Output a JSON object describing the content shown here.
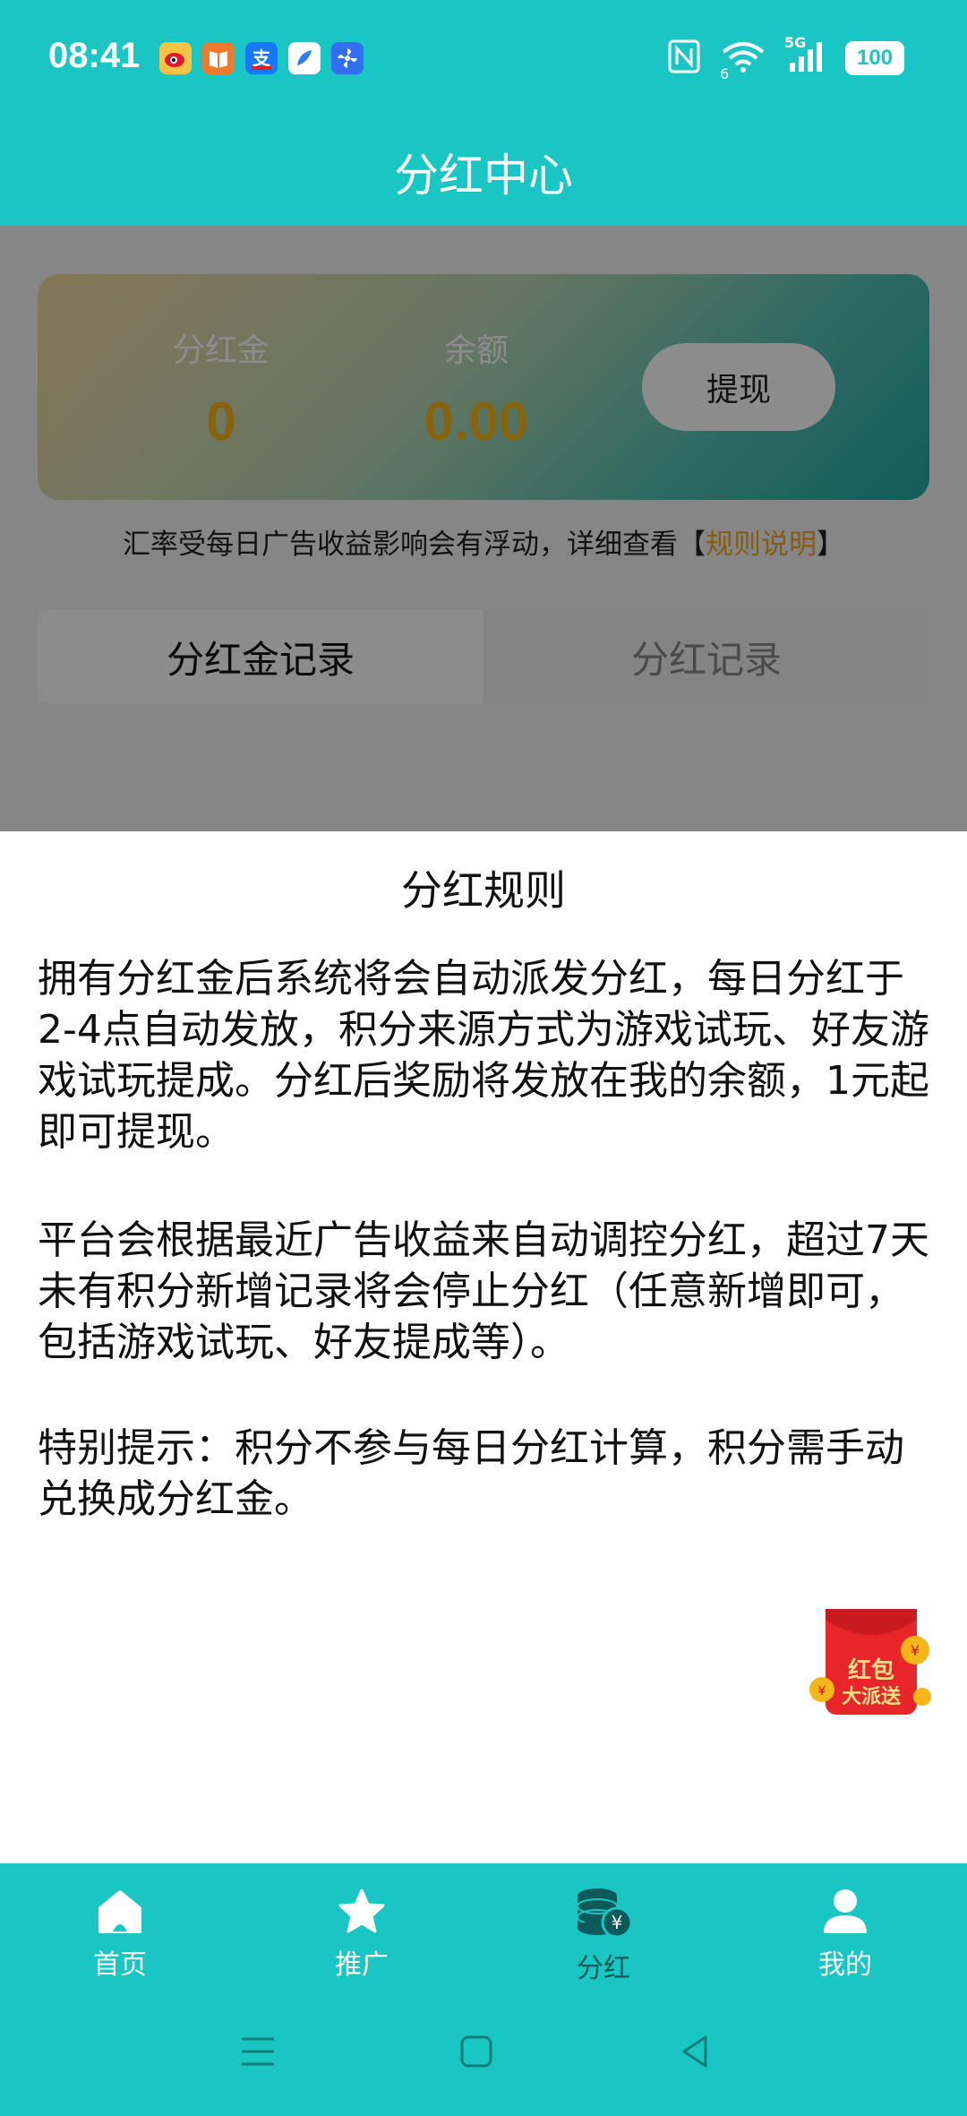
{
  "status_bar": {
    "time": "08:41",
    "notification_icons": [
      "weibo-icon",
      "reader-icon",
      "alipay-icon",
      "browser-icon",
      "pinwheel-icon"
    ],
    "network": "5G",
    "wifi_badge": "6",
    "battery": "100"
  },
  "header": {
    "title": "分红中心"
  },
  "balance_card": {
    "dividend_gold_label": "分红金",
    "dividend_gold_value": "0",
    "balance_label": "余额",
    "balance_value": "0.00",
    "withdraw_label": "提现"
  },
  "rate_note": {
    "text": "汇率受每日广告收益影响会有浮动，详细查看【",
    "link": "规则说明",
    "suffix": "】"
  },
  "tabs": [
    {
      "label": "分红金记录",
      "active": true
    },
    {
      "label": "分红记录",
      "active": false
    }
  ],
  "rules_sheet": {
    "title": "分红规则",
    "paragraphs": [
      "拥有分红金后系统将会自动派发分红，每日分红于2-4点自动发放，积分来源方式为游戏试玩、好友游戏试玩提成。分红后奖励将发放在我的余额，1元起即可提现。",
      "平台会根据最近广告收益来自动调控分红，超过7天未有积分新增记录将会停止分红（任意新增即可，包括游戏试玩、好友提成等）。",
      "特别提示：积分不参与每日分红计算，积分需手动兑换成分红金。"
    ]
  },
  "red_packet": {
    "line1": "红包",
    "line2": "大派送"
  },
  "bottom_nav": [
    {
      "label": "首页",
      "icon": "home-icon",
      "active": false
    },
    {
      "label": "推广",
      "icon": "star-icon",
      "active": false
    },
    {
      "label": "分红",
      "icon": "coins-icon",
      "active": true
    },
    {
      "label": "我的",
      "icon": "user-icon",
      "active": false
    }
  ],
  "colors": {
    "brand": "#19c6c3",
    "accent_gold": "#f5b619",
    "active_nav": "#0d5a5a"
  }
}
